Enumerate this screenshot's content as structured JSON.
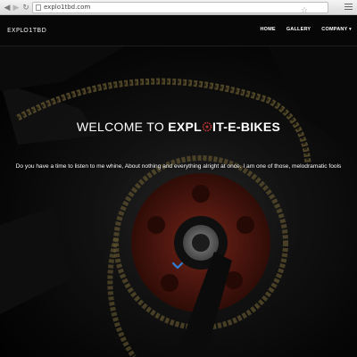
{
  "browser": {
    "url": "explo1tbd.com",
    "back_icon": "arrow-left-icon",
    "forward_icon": "arrow-right-icon",
    "reload_icon": "reload-icon",
    "bookmark_icon": "star-icon",
    "menu_icon": "hamburger-menu-icon"
  },
  "navbar": {
    "brand": "EXPLO1TBD",
    "links": [
      "HOME",
      "GALLERY",
      "COMPANY ▾"
    ]
  },
  "hero": {
    "title_prefix": "WELCOME TO",
    "title_brand_start": "EXPL",
    "title_brand_end": "IT-E-BIKES",
    "text": "Do you have a time to listen to me whine, About nothing and everything alright at once. I am one of those, melodramatic fools",
    "scroll_icon": "chevron-down-icon",
    "colors": {
      "sprocket": "#7a1f14",
      "chain": "#8c7a45",
      "chevron": "#2f7fd6"
    }
  }
}
